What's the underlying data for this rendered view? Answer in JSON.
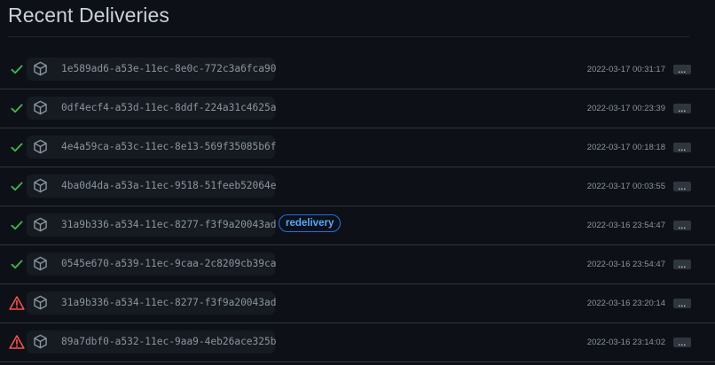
{
  "page": {
    "title": "Recent Deliveries"
  },
  "colors": {
    "success": "#3fb950",
    "failure": "#f85149",
    "accent": "#58a6ff"
  },
  "deliveries": [
    {
      "status": "success",
      "status_icon": "check-icon",
      "guid": "1e589ad6-a53e-11ec-8e0c-772c3a6fca90",
      "badge": "",
      "timestamp": "2022-03-17 00:31:17",
      "more_label": "..."
    },
    {
      "status": "success",
      "status_icon": "check-icon",
      "guid": "0df4ecf4-a53d-11ec-8ddf-224a31c4625a",
      "badge": "",
      "timestamp": "2022-03-17 00:23:39",
      "more_label": "..."
    },
    {
      "status": "success",
      "status_icon": "check-icon",
      "guid": "4e4a59ca-a53c-11ec-8e13-569f35085b6f",
      "badge": "",
      "timestamp": "2022-03-17 00:18:18",
      "more_label": "..."
    },
    {
      "status": "success",
      "status_icon": "check-icon",
      "guid": "4ba0d4da-a53a-11ec-9518-51feeb52064e",
      "badge": "",
      "timestamp": "2022-03-17 00:03:55",
      "more_label": "..."
    },
    {
      "status": "success",
      "status_icon": "check-icon",
      "guid": "31a9b336-a534-11ec-8277-f3f9a20043ad",
      "badge": "redelivery",
      "timestamp": "2022-03-16 23:54:47",
      "more_label": "..."
    },
    {
      "status": "success",
      "status_icon": "check-icon",
      "guid": "0545e670-a539-11ec-9caa-2c8209cb39ca",
      "badge": "",
      "timestamp": "2022-03-16 23:54:47",
      "more_label": "..."
    },
    {
      "status": "failure",
      "status_icon": "alert-triangle-icon",
      "guid": "31a9b336-a534-11ec-8277-f3f9a20043ad",
      "badge": "",
      "timestamp": "2022-03-16 23:20:14",
      "more_label": "..."
    },
    {
      "status": "failure",
      "status_icon": "alert-triangle-icon",
      "guid": "89a7dbf0-a532-11ec-9aa9-4eb26ace325b",
      "badge": "",
      "timestamp": "2022-03-16 23:14:02",
      "more_label": "..."
    }
  ]
}
